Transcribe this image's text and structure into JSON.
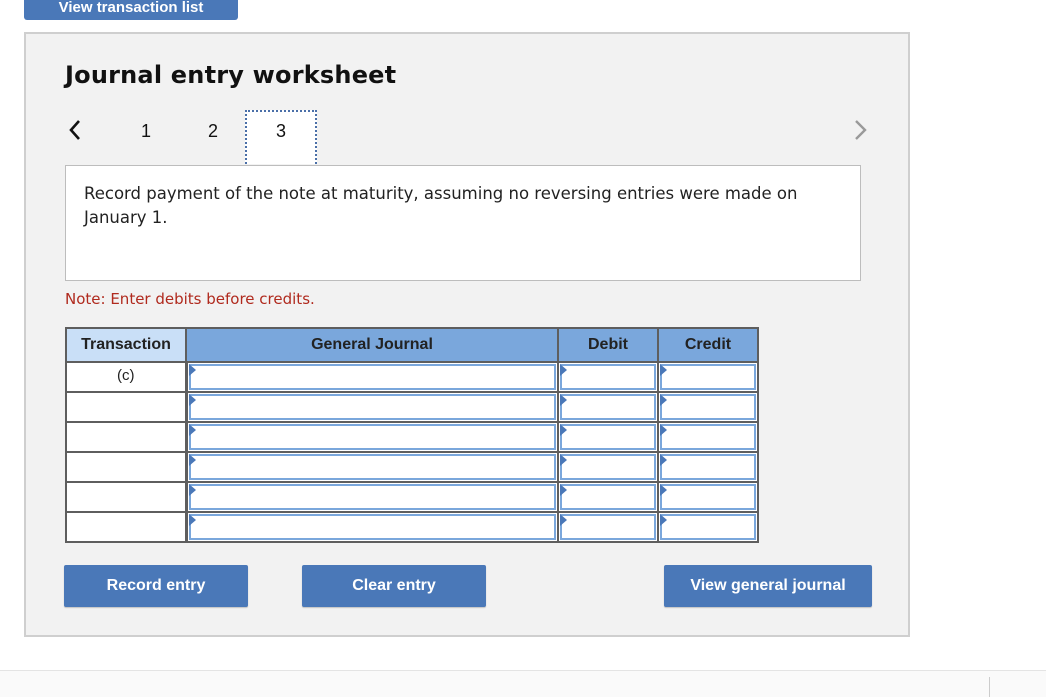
{
  "top_button": {
    "label": "View transaction list"
  },
  "worksheet": {
    "title": "Journal entry worksheet",
    "tabs": [
      "1",
      "2",
      "3"
    ],
    "active_tab": "3",
    "prompt": "Record payment of the note at maturity, assuming no reversing entries were made on January 1.",
    "note": "Note: Enter debits before credits."
  },
  "table": {
    "headers": {
      "transaction": "Transaction",
      "general_journal": "General Journal",
      "debit": "Debit",
      "credit": "Credit"
    },
    "rows": [
      {
        "transaction": "(c)",
        "account": "",
        "debit": "",
        "credit": ""
      },
      {
        "transaction": "",
        "account": "",
        "debit": "",
        "credit": ""
      },
      {
        "transaction": "",
        "account": "",
        "debit": "",
        "credit": ""
      },
      {
        "transaction": "",
        "account": "",
        "debit": "",
        "credit": ""
      },
      {
        "transaction": "",
        "account": "",
        "debit": "",
        "credit": ""
      },
      {
        "transaction": "",
        "account": "",
        "debit": "",
        "credit": ""
      }
    ]
  },
  "buttons": {
    "record": "Record entry",
    "clear": "Clear entry",
    "view_journal": "View general journal"
  },
  "colors": {
    "accent": "#4a78b8",
    "header": "#7aa7dc",
    "note": "#b02a1e"
  },
  "icons": {
    "prev": "chevron-left-icon",
    "next": "chevron-right-icon"
  }
}
